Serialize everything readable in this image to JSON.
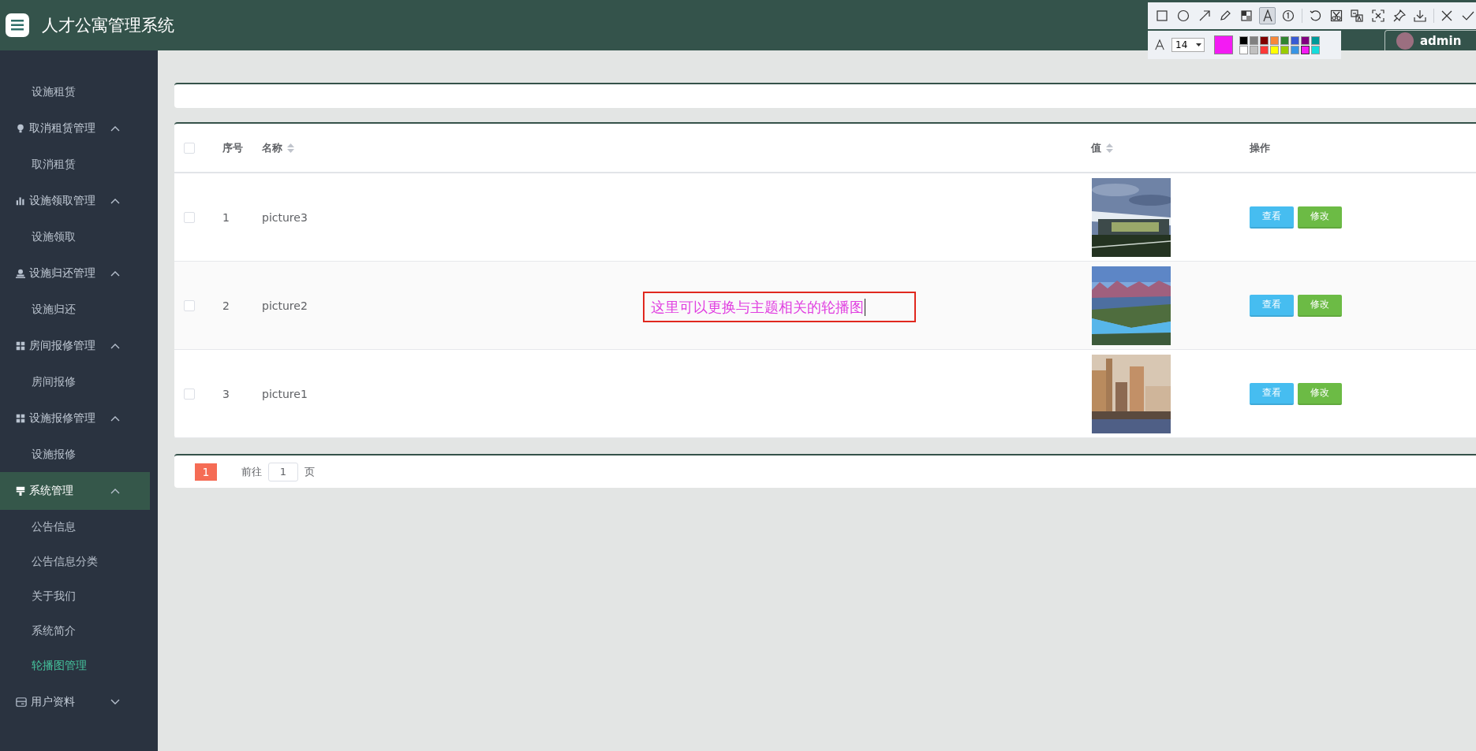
{
  "header": {
    "title": "人才公寓管理系统",
    "user": "admin"
  },
  "sidebar": {
    "items": [
      {
        "kind": "sub",
        "label": "设施租赁",
        "selected": false
      },
      {
        "kind": "group",
        "label": "取消租赁管理",
        "expanded": true,
        "selected": false,
        "children": [
          {
            "label": "取消租赁",
            "selected": false
          }
        ]
      },
      {
        "kind": "group",
        "label": "设施领取管理",
        "expanded": true,
        "selected": false,
        "children": [
          {
            "label": "设施领取",
            "selected": false
          }
        ]
      },
      {
        "kind": "group",
        "label": "设施归还管理",
        "expanded": true,
        "selected": false,
        "children": [
          {
            "label": "设施归还",
            "selected": false
          }
        ]
      },
      {
        "kind": "group",
        "label": "房间报修管理",
        "expanded": true,
        "selected": false,
        "children": [
          {
            "label": "房间报修",
            "selected": false
          }
        ]
      },
      {
        "kind": "group",
        "label": "设施报修管理",
        "expanded": true,
        "selected": false,
        "children": [
          {
            "label": "设施报修",
            "selected": false
          }
        ]
      },
      {
        "kind": "group",
        "label": "系统管理",
        "expanded": true,
        "selected": true,
        "children": [
          {
            "label": "公告信息",
            "selected": false
          },
          {
            "label": "公告信息分类",
            "selected": false
          },
          {
            "label": "关于我们",
            "selected": false
          },
          {
            "label": "系统简介",
            "selected": false
          },
          {
            "label": "轮播图管理",
            "selected": true
          }
        ]
      },
      {
        "kind": "group",
        "label": "用户资料",
        "expanded": false,
        "selected": false
      }
    ]
  },
  "table": {
    "select_all": {
      "checked": false
    },
    "columns": [
      {
        "label": "序号",
        "sortable": false
      },
      {
        "label": "名称",
        "sortable": true
      },
      {
        "label": "值",
        "sortable": true
      },
      {
        "label": "操作",
        "sortable": false
      }
    ],
    "rows": [
      {
        "checked": false,
        "index": "1",
        "name": "picture3",
        "value": {
          "kind": "picture"
        },
        "actions": [
          "查看",
          "修改"
        ]
      },
      {
        "checked": false,
        "index": "2",
        "name": "picture2",
        "value": {
          "kind": "picture"
        },
        "actions": [
          "查看",
          "修改"
        ]
      },
      {
        "checked": false,
        "index": "3",
        "name": "picture1",
        "value": {
          "kind": "picture"
        },
        "actions": [
          "查看",
          "修改"
        ]
      }
    ]
  },
  "pagination": {
    "pages": [
      {
        "label": "1",
        "selected": true
      }
    ],
    "goto_label": "前往",
    "goto_value": "1",
    "goto_suffix": "页"
  },
  "annotation": {
    "text": "这里可以更换与主题相关的轮播图",
    "tools": [
      {
        "kind": "rectangle",
        "selected": false
      },
      {
        "kind": "ellipse",
        "selected": false
      },
      {
        "kind": "arrow",
        "selected": false
      },
      {
        "kind": "pencil",
        "selected": false
      },
      {
        "kind": "mosaic",
        "selected": false
      },
      {
        "kind": "text",
        "selected": true
      },
      {
        "kind": "number",
        "selected": false
      },
      {
        "kind": "separator"
      },
      {
        "kind": "undo",
        "selected": false
      },
      {
        "kind": "scissors",
        "selected": false
      },
      {
        "kind": "translate",
        "selected": false
      },
      {
        "kind": "crop",
        "selected": false
      },
      {
        "kind": "pin",
        "selected": false
      },
      {
        "kind": "download",
        "selected": false
      },
      {
        "kind": "separator"
      },
      {
        "kind": "close",
        "selected": false
      },
      {
        "kind": "confirm",
        "selected": false
      }
    ],
    "font_size": "14",
    "swatches": [
      {
        "color": "#000000",
        "selected": false
      },
      {
        "color": "#808080",
        "selected": false
      },
      {
        "color": "#800000",
        "selected": false
      },
      {
        "color": "#f7883a",
        "selected": false
      },
      {
        "color": "#308430",
        "selected": false
      },
      {
        "color": "#385ad3",
        "selected": false
      },
      {
        "color": "#800080",
        "selected": false
      },
      {
        "color": "#009999",
        "selected": false
      },
      {
        "color": "#ffffff",
        "selected": false
      },
      {
        "color": "#c0c0c0",
        "selected": false
      },
      {
        "color": "#fb3838",
        "selected": false
      },
      {
        "color": "#ffff00",
        "selected": false
      },
      {
        "color": "#99cc00",
        "selected": false
      },
      {
        "color": "#3894e4",
        "selected": false
      },
      {
        "color": "#f31bf3",
        "selected": true
      },
      {
        "color": "#16dcdc",
        "selected": false
      }
    ]
  }
}
